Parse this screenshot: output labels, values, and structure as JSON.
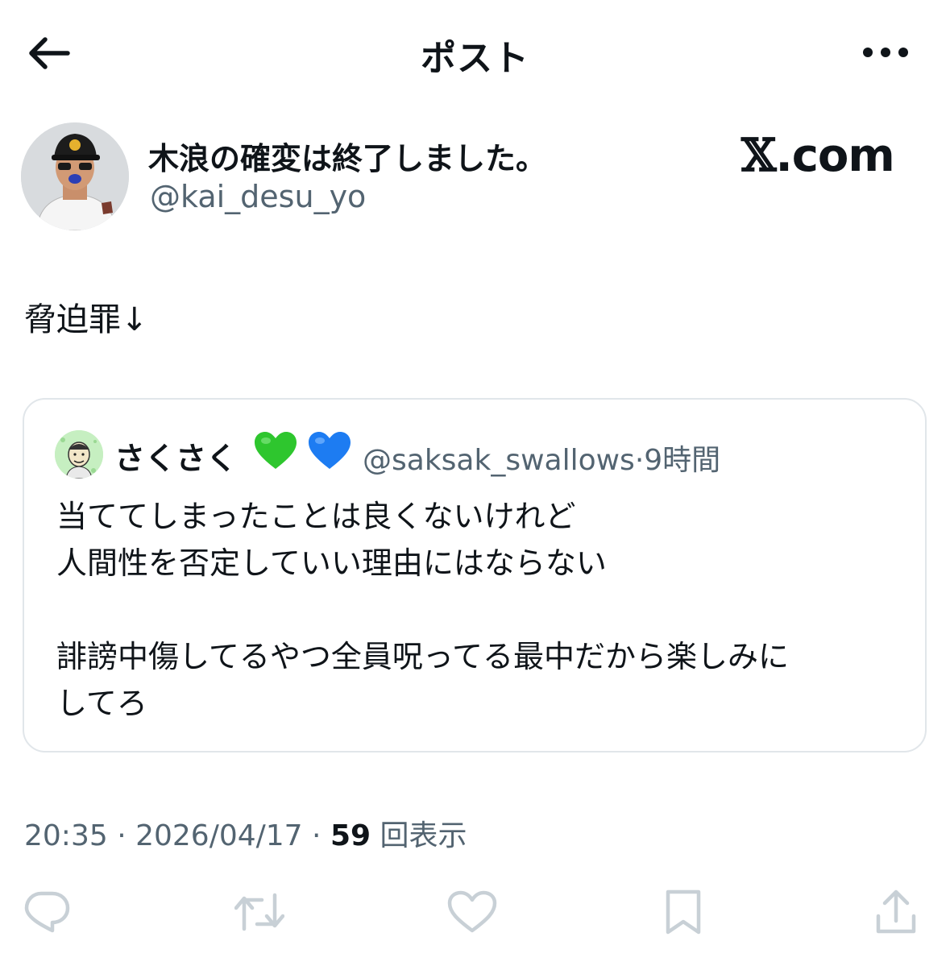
{
  "header": {
    "title": "ポスト",
    "back_icon": "arrow-left-icon",
    "more_icon": "more-horizontal-icon"
  },
  "author": {
    "display_name": "木浪の確変は終了しました。",
    "handle": "@kai_desu_yo",
    "avatar_icon": "baseball-player-avatar"
  },
  "watermark": {
    "x_mark": "𝕏",
    "domain": ".com"
  },
  "tweet": {
    "text": "脅迫罪↓"
  },
  "quote": {
    "name": "さくさく",
    "hearts": [
      "green-heart-icon",
      "blue-heart-icon"
    ],
    "handle": "@saksak_swallows",
    "separator": "·",
    "time": "9時間",
    "lines": [
      "当ててしまったことは良くないけれど",
      "人間性を否定していい理由にはならない",
      "",
      "誹謗中傷してるやつ全員呪ってる最中だから楽しみに",
      "してろ"
    ]
  },
  "meta": {
    "time": "20:35",
    "sep1": " · ",
    "date": "2026/04/17",
    "sep2": " · ",
    "views_count": "59",
    "views_label": "回表示"
  },
  "actions": [
    "reply-icon",
    "retweet-icon",
    "like-icon",
    "bookmark-icon",
    "share-icon"
  ],
  "colors": {
    "text": "#0f1419",
    "secondary": "#536471",
    "icon": "#c8d0d6",
    "border": "#e1e6ea",
    "green_heart": "#2ec62e",
    "blue_heart": "#1d7cf2"
  }
}
